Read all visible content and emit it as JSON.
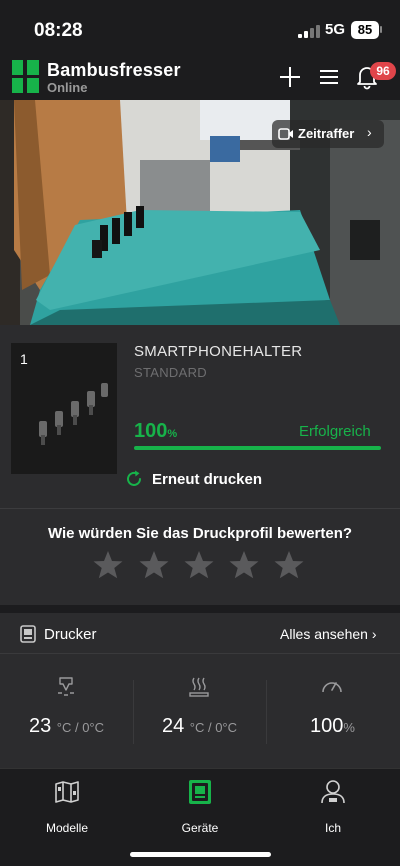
{
  "status_bar": {
    "time": "08:28",
    "network": "5G",
    "battery": "85"
  },
  "header": {
    "title": "Bambusfresser",
    "subtitle": "Online",
    "notification_count": "96"
  },
  "camera": {
    "timelapse_label": "Zeitraffer"
  },
  "job": {
    "plate_number": "1",
    "title": "SMARTPHONEHALTER",
    "profile": "STANDARD",
    "progress_value": "100",
    "progress_unit": "%",
    "progress": 1.0,
    "result": "Erfolgreich",
    "reprint_label": "Erneut drucken"
  },
  "rating": {
    "question": "Wie würden Sie das Druckprofil bewerten?",
    "stars": 5,
    "rated": 0
  },
  "printer": {
    "label": "Drucker",
    "see_all": "Alles ansehen",
    "stats": [
      {
        "value": "23",
        "unit": "°C / 0°C",
        "icon": "nozzle-temperature-icon"
      },
      {
        "value": "24",
        "unit": "°C / 0°C",
        "icon": "bed-temperature-icon"
      },
      {
        "value": "100",
        "unit": "%",
        "icon": "speed-gauge-icon"
      }
    ]
  },
  "tabs": [
    {
      "label": "Modelle",
      "icon": "models-icon",
      "active": false
    },
    {
      "label": "Geräte",
      "icon": "devices-icon",
      "active": true
    },
    {
      "label": "Ich",
      "icon": "profile-icon",
      "active": false
    }
  ],
  "colors": {
    "accent": "#17b34a",
    "background": "#1c1c1e",
    "card": "#2c2c2e",
    "badge": "#e0454a"
  }
}
